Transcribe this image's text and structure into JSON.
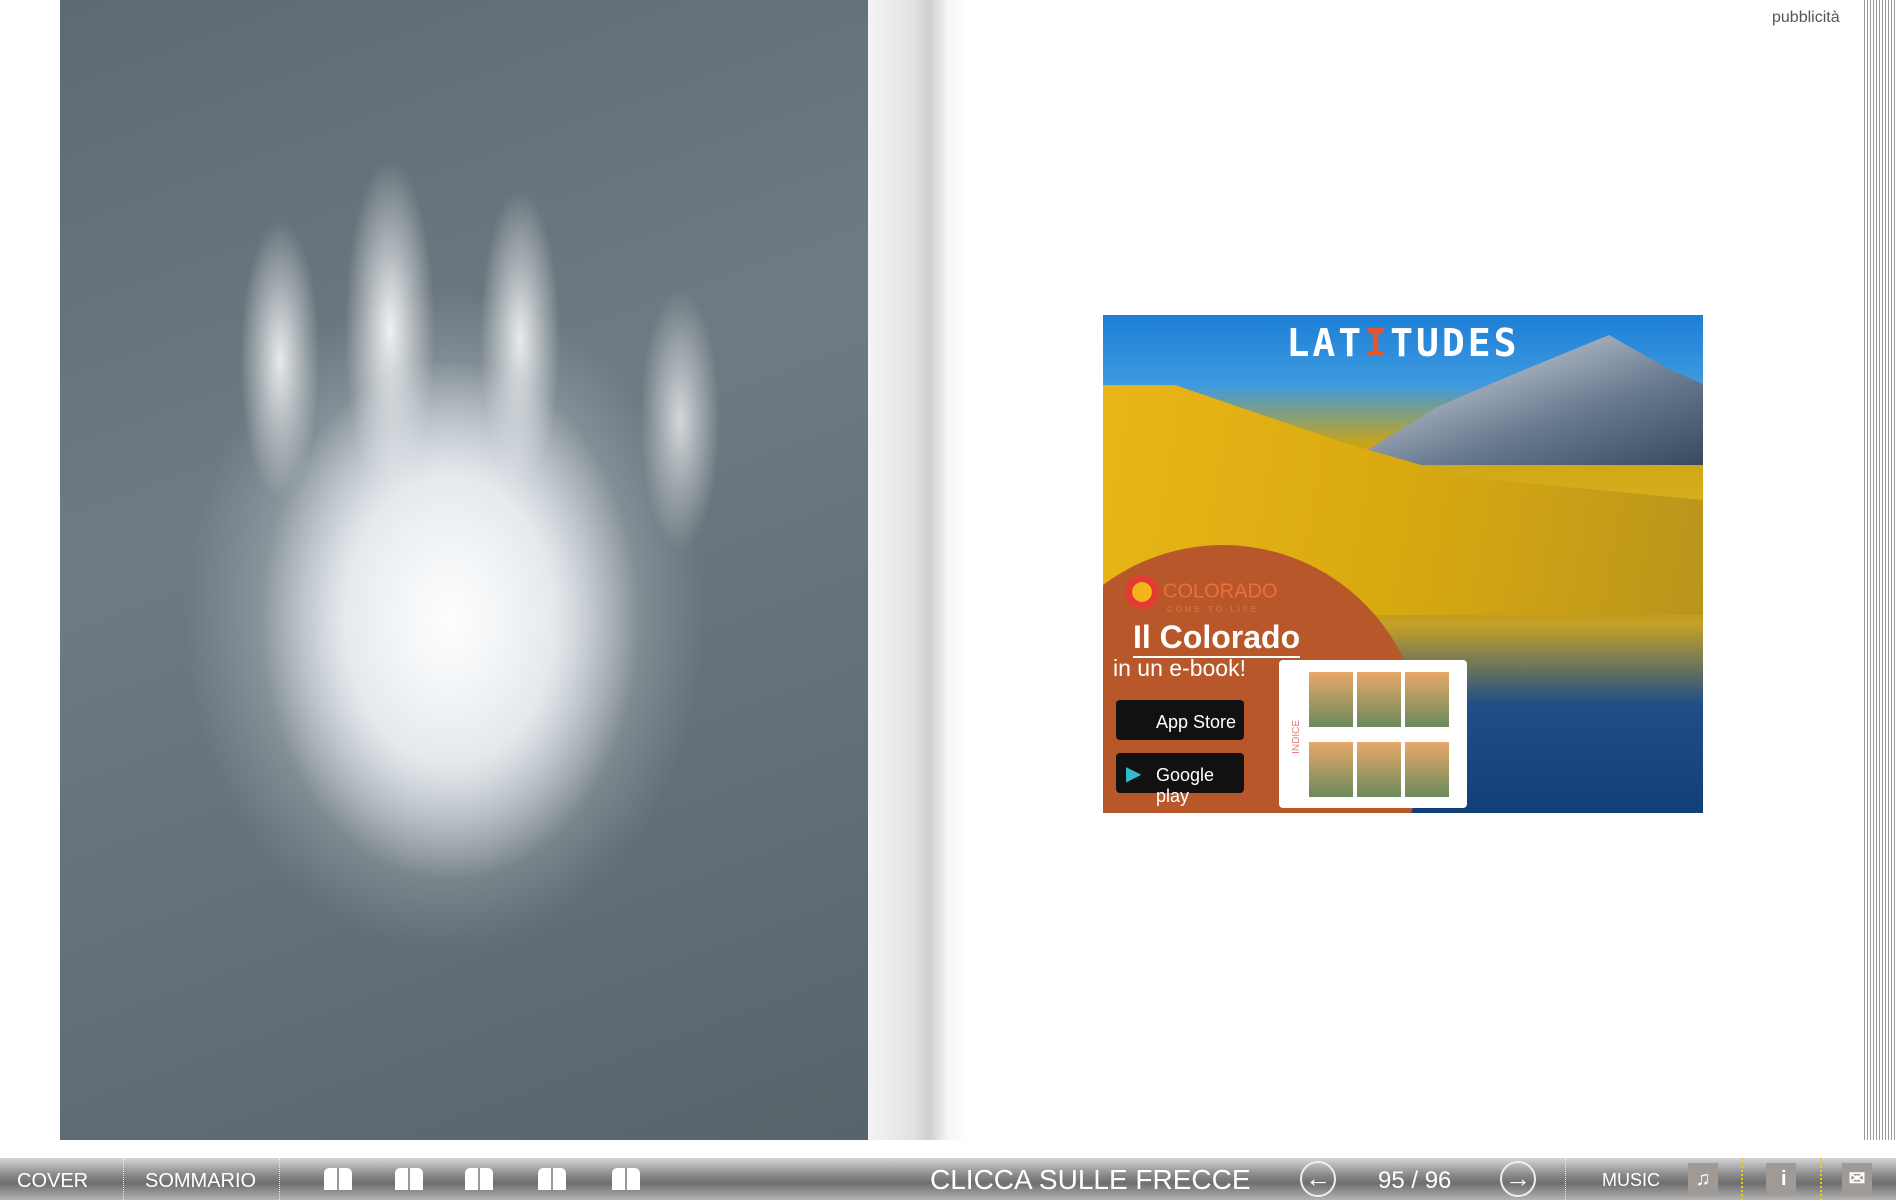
{
  "page": {
    "label": "pubblicità"
  },
  "ad": {
    "brand": "LATITUDES",
    "brand_pre": "LAT",
    "brand_accent": "I",
    "brand_post": "TUDES",
    "partner": "COLORADO",
    "partner_tagline": "COME TO LIFE",
    "headline": "Il Colorado",
    "subheadline": "in un e-book!",
    "app_store": "App Store",
    "google_play": "Google play",
    "tablet_label": "INDICE"
  },
  "toolbar": {
    "cover": "COVER",
    "sommario": "SOMMARIO",
    "instruction": "CLICCA SULLE FRECCE",
    "page_indicator": "95 / 96",
    "music": "MUSIC",
    "info": "i",
    "prev_icon": "arrow-left",
    "next_icon": "arrow-right"
  },
  "colors": {
    "toolbar": "#7a7a7a",
    "accent": "#e4552b",
    "ad_orange": "#b8582a"
  }
}
